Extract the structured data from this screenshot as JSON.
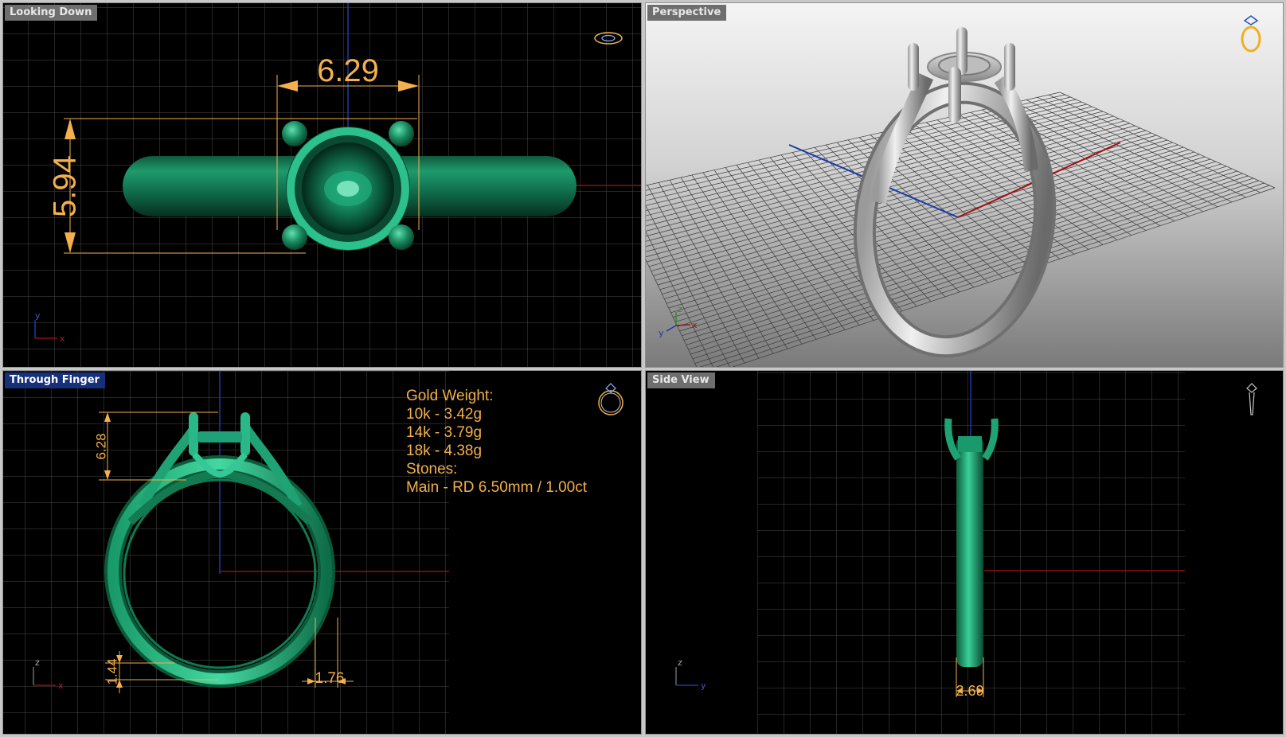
{
  "viewports": {
    "top": {
      "title": "Looking Down",
      "dims": {
        "width": "6.29",
        "height": "5.94"
      },
      "axes": {
        "a": "y",
        "b": "x"
      }
    },
    "perspective": {
      "title": "Perspective",
      "axes": {
        "a": "z",
        "b": "y",
        "c": "x"
      }
    },
    "front": {
      "title": "Through Finger",
      "dims": {
        "head_height": "6.28",
        "shank_thickness": "1.44",
        "shank_width": "1.76"
      },
      "axes": {
        "a": "z",
        "b": "x"
      },
      "info": {
        "gold_weight_label": "Gold Weight:",
        "weights": [
          "10k - 3.42g",
          "14k - 3.79g",
          "18k - 4.38g"
        ],
        "stones_label": "Stones:",
        "stone": "Main - RD 6.50mm / 1.00ct"
      }
    },
    "side": {
      "title": "Side View",
      "dims": {
        "width": "2.69"
      },
      "axes": {
        "a": "z",
        "b": "y"
      }
    }
  },
  "colors": {
    "model_green": "#1c9a6c",
    "dimension": "#f3b04c",
    "grid": "#4a4a4a",
    "axis_x": "#8a1010",
    "axis_y": "#1a3aa8",
    "viewport_title_bg": "#6e6e6e",
    "active_title_bg": "#16307a"
  }
}
